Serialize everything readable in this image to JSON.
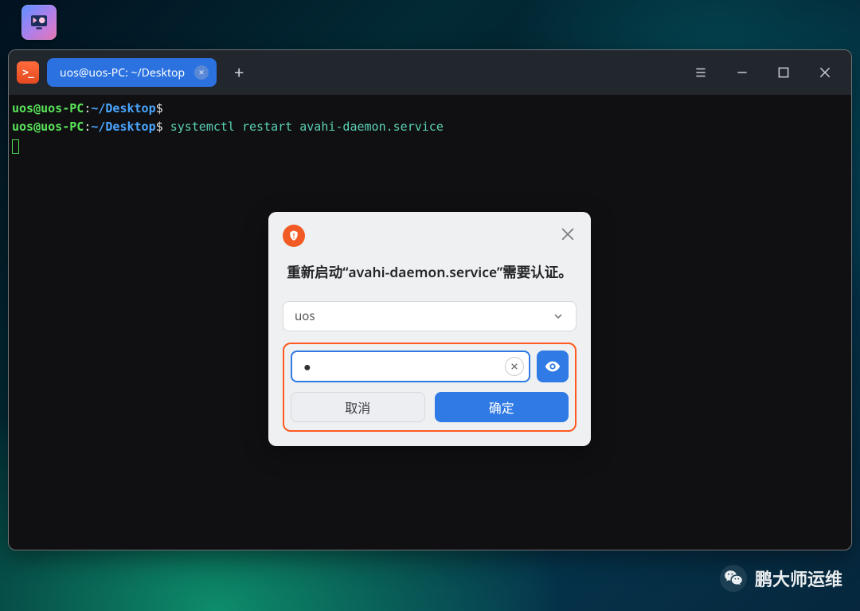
{
  "desktop": {
    "icon_name": "monitor-icon"
  },
  "terminal": {
    "tab_title": "uos@uos-PC: ~/Desktop",
    "prompt_user": "uos@uos-PC",
    "prompt_sep": ":",
    "prompt_path": "~/Desktop",
    "prompt_symbol": "$",
    "lines": [
      {
        "command": ""
      },
      {
        "command": "systemctl restart avahi-daemon.service"
      }
    ]
  },
  "dialog": {
    "message": "重新启动“avahi-daemon.service”需要认证。",
    "user_selected": "uos",
    "password_mask": "●",
    "cancel_label": "取消",
    "ok_label": "确定"
  },
  "watermark": {
    "text": "鹏大师运维"
  }
}
